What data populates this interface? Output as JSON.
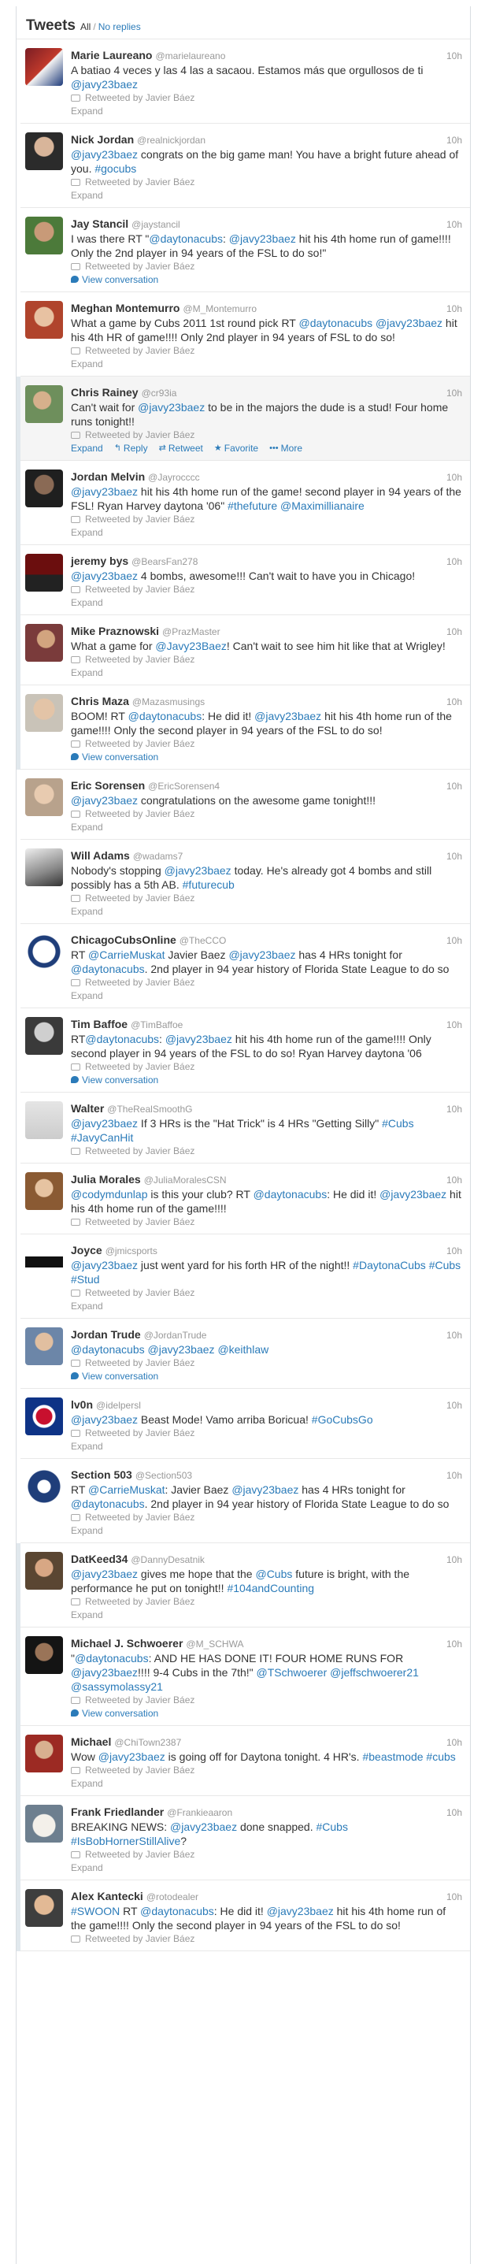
{
  "header": {
    "title": "Tweets",
    "filter_all": "All",
    "separator": "/",
    "filter_no_replies": "No replies"
  },
  "labels": {
    "retweeted_by": "Retweeted by Javier Báez",
    "expand": "Expand",
    "view_conversation": "View conversation",
    "reply": "Reply",
    "retweet": "Retweet",
    "favorite": "Favorite",
    "more": "More"
  },
  "colors": {
    "link": "#2b7bb9",
    "muted": "#999999",
    "text": "#333333",
    "group_bar": "#e1e8ed",
    "hover_bg": "#f5f5f5"
  },
  "tweets": [
    {
      "name": "Marie Laureano",
      "handle": "@marielaureano",
      "time": "10h",
      "parts": [
        "A batiao 4 veces y las 4 las a sacaou. Estamos más que orgullosos de ti ",
        "@javy23baez"
      ],
      "action": "expand",
      "avatar": "avatar-red-flag",
      "group": 0
    },
    {
      "name": "Nick Jordan",
      "handle": "@realnickjordan",
      "time": "10h",
      "parts": [
        "@javy23baez",
        " congrats on the big game man! You have a bright future ahead of you. ",
        "#gocubs"
      ],
      "action": "expand",
      "avatar": "avatar-person-dark",
      "group": 0
    },
    {
      "name": "Jay Stancil",
      "handle": "@jaystancil",
      "time": "10h",
      "parts": [
        "I was there RT \"",
        "@daytonacubs",
        ": ",
        "@javy23baez",
        " hit his 4th home run of game!!!! Only the 2nd player in 94 years of the FSL to do so!\""
      ],
      "action": "conversation",
      "avatar": "avatar-person-outdoor",
      "group": 0
    },
    {
      "name": "Meghan Montemurro",
      "handle": "@M_Montemurro",
      "time": "10h",
      "parts": [
        "What a game by Cubs 2011 1st round pick RT ",
        "@daytonacubs",
        " ",
        "@javy23baez",
        " hit his 4th HR of game!!!! Only 2nd player in 94 years of FSL to do so!"
      ],
      "action": "expand",
      "avatar": "avatar-person-red",
      "group": 0
    },
    {
      "name": "Chris Rainey",
      "handle": "@cr93ia",
      "time": "10h",
      "parts": [
        "Can't wait for ",
        "@javy23baez",
        " to be in the majors the dude is a stud! Four home runs tonight!!"
      ],
      "action": "full",
      "avatar": "avatar-person-green",
      "group": 1,
      "hovered": true
    },
    {
      "name": "Jordan Melvin",
      "handle": "@Jayrocccc",
      "time": "10h",
      "parts": [
        "@javy23baez",
        " hit his 4th home run of the game! second player in 94 years of the FSL! Ryan Harvey daytona '06\" ",
        "#thefuture",
        " ",
        "@Maximillianaire"
      ],
      "action": "expand",
      "avatar": "avatar-person-dark2",
      "group": 1
    },
    {
      "name": "jeremy bys",
      "handle": "@BearsFan278",
      "time": "10h",
      "parts": [
        "@javy23baez",
        " 4 bombs, awesome!!!  Can't wait to have you in Chicago!"
      ],
      "action": "expand",
      "avatar": "avatar-hawks",
      "group": 1
    },
    {
      "name": "Mike Praznowski",
      "handle": "@PrazMaster",
      "time": "10h",
      "parts": [
        "What a game for ",
        "@Javy23Baez",
        "! Can't wait to see him hit like that at Wrigley!"
      ],
      "action": "expand",
      "avatar": "avatar-person-crowd",
      "group": 1
    },
    {
      "name": "Chris Maza",
      "handle": "@Mazasmusings",
      "time": "10h",
      "parts": [
        "BOOM! RT ",
        "@daytonacubs",
        ": He did it! ",
        "@javy23baez",
        " hit his 4th home run of the game!!!! Only the second player in 94 years of the FSL to do so!"
      ],
      "action": "conversation",
      "avatar": "avatar-person-light",
      "group": 1
    },
    {
      "name": "Eric Sorensen",
      "handle": "@EricSorensen4",
      "time": "10h",
      "parts": [
        "@javy23baez",
        " congratulations on the awesome game tonight!!!"
      ],
      "action": "expand",
      "avatar": "avatar-person-pale",
      "group": 2
    },
    {
      "name": "Will Adams",
      "handle": "@wadams7",
      "time": "10h",
      "parts": [
        "Nobody's stopping ",
        "@javy23baez",
        " today. He's already got 4 bombs and still possibly has a 5th AB. ",
        "#futurecub"
      ],
      "action": "expand",
      "avatar": "avatar-player-bw",
      "group": 2
    },
    {
      "name": "ChicagoCubsOnline",
      "handle": "@TheCCO",
      "time": "10h",
      "parts": [
        "RT ",
        "@CarrieMuskat",
        " Javier Baez ",
        "@javy23baez",
        " has 4 HRs tonight for ",
        "@daytonacubs",
        ". 2nd player in 94 year history of Florida State League to do so"
      ],
      "action": "expand",
      "avatar": "avatar-cubs-logo",
      "group": 2
    },
    {
      "name": "Tim Baffoe",
      "handle": "@TimBaffoe",
      "time": "10h",
      "parts": [
        "RT",
        "@daytonacubs",
        ": ",
        "@javy23baez",
        " hit his 4th home run of the game!!!! Only second player in 94 years of the FSL to do so! Ryan Harvey daytona '06"
      ],
      "action": "conversation",
      "avatar": "avatar-person-bw",
      "group": 2
    },
    {
      "name": "Walter",
      "handle": "@TheRealSmoothG",
      "time": "10h",
      "parts": [
        "@javy23baez",
        " If 3 HRs is the \"Hat Trick\" is 4 HRs \"Getting Silly\" ",
        "#Cubs",
        " ",
        "#JavyCanHit"
      ],
      "action": "none",
      "avatar": "avatar-person-plain",
      "group": 2
    },
    {
      "name": "Julia Morales",
      "handle": "@JuliaMoralesCSN",
      "time": "10h",
      "parts": [
        "@codymdunlap",
        " is this your club? RT ",
        "@daytonacubs",
        ": He did it! ",
        "@javy23baez",
        " hit his 4th home run of the game!!!!"
      ],
      "action": "none",
      "avatar": "avatar-person-woman",
      "group": 2
    },
    {
      "name": "Joyce",
      "handle": "@jmicsports",
      "time": "10h",
      "parts": [
        "@javy23baez",
        " just went yard for his forth HR of the night!! ",
        "#DaytonaCubs",
        " ",
        "#Cubs",
        " ",
        "#Stud"
      ],
      "action": "expand",
      "avatar": "avatar-sports-logo",
      "group": 2
    },
    {
      "name": "Jordan Trude",
      "handle": "@JordanTrude",
      "time": "10h",
      "parts": [
        "@daytonacubs",
        " ",
        "@javy23baez",
        " ",
        "@keithlaw"
      ],
      "action": "conversation",
      "avatar": "avatar-person-suit",
      "group": 2
    },
    {
      "name": "lv0n",
      "handle": "@idelpersl",
      "time": "10h",
      "parts": [
        "@javy23baez",
        " Beast Mode! Vamo arriba Boricua! ",
        "#GoCubsGo"
      ],
      "action": "expand",
      "avatar": "avatar-cubs-bear",
      "group": 2
    },
    {
      "name": "Section 503",
      "handle": "@Section503",
      "time": "10h",
      "parts": [
        "RT ",
        "@CarrieMuskat",
        ": Javier Baez ",
        "@javy23baez",
        " has 4 HRs tonight for ",
        "@daytonacubs",
        ". 2nd player in 94 year history of Florida State League to do so"
      ],
      "action": "expand",
      "avatar": "avatar-chicago-503",
      "group": 2
    },
    {
      "name": "DatKeed34",
      "handle": "@DannyDesatnik",
      "time": "10h",
      "parts": [
        "@javy23baez",
        " gives me hope that the ",
        "@Cubs",
        "  future is bright, with the performance he put on tonight!! ",
        "#104andCounting"
      ],
      "action": "expand",
      "avatar": "avatar-person-crowd2",
      "group": 3
    },
    {
      "name": "Michael J. Schwoerer",
      "handle": "@M_SCHWA",
      "time": "10h",
      "parts": [
        "\"",
        "@daytonacubs",
        ": AND HE HAS DONE IT! FOUR HOME RUNS FOR ",
        "@javy23baez",
        "!!!! 9-4 Cubs in the 7th!\" ",
        "@TSchwoerer",
        " ",
        "@jeffschwoerer21",
        " ",
        "@sassymolassy21"
      ],
      "action": "conversation",
      "avatar": "avatar-person-dark3",
      "group": 3
    },
    {
      "name": "Michael",
      "handle": "@ChiTown2387",
      "time": "10h",
      "parts": [
        "Wow ",
        "@javy23baez",
        " is going off for Daytona tonight. 4 HR's. ",
        "#beastmode",
        " ",
        "#cubs"
      ],
      "action": "expand",
      "avatar": "avatar-person-red2",
      "group": 3
    },
    {
      "name": "Frank Friedlander",
      "handle": "@Frankieaaron",
      "time": "10h",
      "parts": [
        "BREAKING NEWS: ",
        "@javy23baez",
        " done snapped. ",
        "#Cubs",
        " ",
        "#IsBobHornerStillAlive",
        "?"
      ],
      "action": "expand",
      "avatar": "avatar-dog",
      "group": 3
    },
    {
      "name": "Alex Kantecki",
      "handle": "@rotodealer",
      "time": "10h",
      "parts": [
        "#SWOON",
        " RT ",
        "@daytonacubs",
        ": He did it! ",
        "@javy23baez",
        " hit his 4th home run of the game!!!! Only the second player in 94 years of the FSL to do so!"
      ],
      "action": "none",
      "avatar": "avatar-person-glasses",
      "group": 3
    }
  ]
}
